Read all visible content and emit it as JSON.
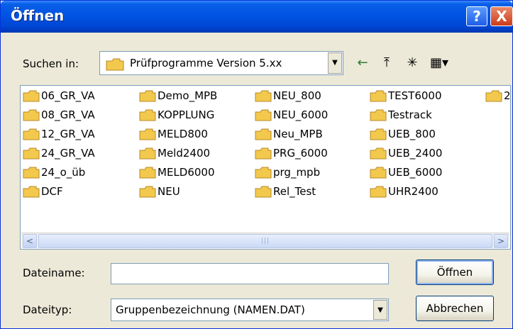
{
  "window": {
    "title": "Öffnen"
  },
  "titlebar": {
    "help_label": "?",
    "close_label": "X"
  },
  "lookin": {
    "label": "Suchen in:",
    "value": "Prüfprogramme Version 5.xx",
    "dropdown_glyph": "▼"
  },
  "toolbar": {
    "back_icon": "←",
    "up_icon": "⤒",
    "new_folder_icon": "✳",
    "views_icon": "▦▾"
  },
  "files": [
    [
      "06_GR_VA",
      "Demo_MPB",
      "NEU_800",
      "TEST6000"
    ],
    [
      "08_GR_VA",
      "KOPPLUNG",
      "NEU_6000",
      "Testrack"
    ],
    [
      "12_GR_VA",
      "MELD800",
      "Neu_MPB",
      "UEB_800"
    ],
    [
      "24_GR_VA",
      "Meld2400",
      "PRG_6000",
      "UEB_2400"
    ],
    [
      "24_o_üb",
      "MELD6000",
      "prg_mpb",
      "UEB_6000"
    ],
    [
      "DCF",
      "NEU",
      "Rel_Test",
      "UHR2400"
    ]
  ],
  "files_flat": [
    "06_GR_VA",
    "08_GR_VA",
    "12_GR_VA",
    "24_GR_VA",
    "24_o_üb",
    "DCF",
    "Demo_MPB",
    "KOPPLUNG",
    "MELD800",
    "Meld2400",
    "MELD6000",
    "NEU",
    "NEU_800",
    "NEU_6000",
    "Neu_MPB",
    "PRG_6000",
    "prg_mpb",
    "Rel_Test",
    "TEST6000",
    "Testrack",
    "UEB_800",
    "UEB_2400",
    "UEB_6000",
    "UHR2400"
  ],
  "partial_item": "2",
  "scrollbar": {
    "left_glyph": "<",
    "right_glyph": ">",
    "thumb_grip": "|||"
  },
  "filename": {
    "label": "Dateiname:",
    "value": ""
  },
  "filetype": {
    "label": "Dateityp:",
    "value": "Gruppenbezeichnung (NAMEN.DAT)",
    "dropdown_glyph": "▼"
  },
  "buttons": {
    "open": "Öffnen",
    "cancel": "Abbrechen"
  },
  "colors": {
    "folder": "#f2c94c",
    "titlebar": "#0054e3",
    "dialog_bg": "#ece9d8"
  }
}
